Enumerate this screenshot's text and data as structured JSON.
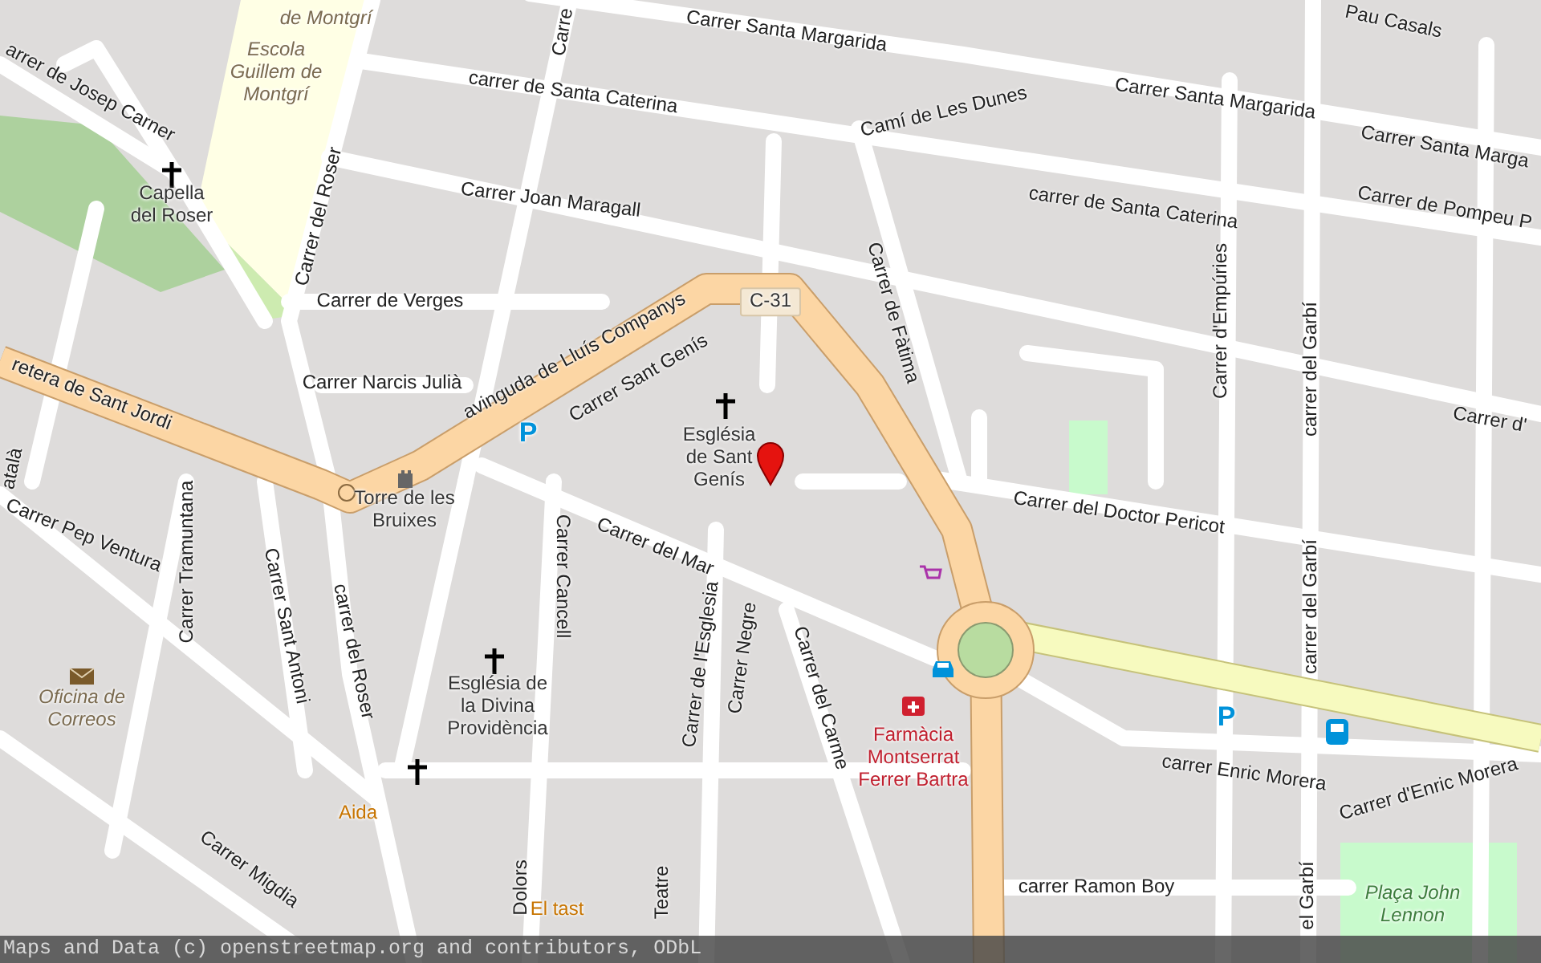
{
  "map": {
    "labels": [
      {
        "kind": "place",
        "text": "de Montgrí"
      },
      {
        "kind": "street",
        "text": "Carre"
      },
      {
        "kind": "street",
        "text": "Carrer Santa Margarida"
      },
      {
        "kind": "street",
        "text": "Pau Casals"
      },
      {
        "kind": "place",
        "text": "Escola Guillem de Montgrí"
      },
      {
        "kind": "street",
        "text": "carrer de Santa Caterina"
      },
      {
        "kind": "street",
        "text": "Camí de Les Dunes"
      },
      {
        "kind": "street",
        "text": "Carrer Santa Margarida"
      },
      {
        "kind": "street",
        "text": "Carrer Santa Marga"
      },
      {
        "kind": "street",
        "text": "arrer de Josep Carner"
      },
      {
        "kind": "street",
        "text": "carrer de Santa Caterina"
      },
      {
        "kind": "street",
        "text": "Carrer de Pompeu P"
      },
      {
        "kind": "poi",
        "text": "Capella del Roser"
      },
      {
        "kind": "street",
        "text": "Carrer del Roser"
      },
      {
        "kind": "street",
        "text": "Carrer Joan Maragall"
      },
      {
        "kind": "street",
        "text": "Carrer de Verges"
      },
      {
        "kind": "road_ref",
        "text": "C-31"
      },
      {
        "kind": "street",
        "text": "Carrer de Fàtima"
      },
      {
        "kind": "street",
        "text": "Carrer d'Empúries"
      },
      {
        "kind": "street",
        "text": "carrer del Garbí"
      },
      {
        "kind": "street",
        "text": "retera de Sant Jordi"
      },
      {
        "kind": "street",
        "text": "avinguda de Lluís Companys"
      },
      {
        "kind": "street",
        "text": "Carrer Sant Genís"
      },
      {
        "kind": "street",
        "text": "Carrer Narcis Julià"
      },
      {
        "kind": "parking",
        "text": "P"
      },
      {
        "kind": "poi",
        "text": "Església de Sant Genís"
      },
      {
        "kind": "street",
        "text": "Carrer d'"
      },
      {
        "kind": "street",
        "text": "atalà"
      },
      {
        "kind": "poi",
        "text": "Torre de les Bruixes"
      },
      {
        "kind": "street",
        "text": "Carrer del Doctor Pericot"
      },
      {
        "kind": "street",
        "text": "Carrer Pep Ventura"
      },
      {
        "kind": "street",
        "text": "Carrer Tramuntana"
      },
      {
        "kind": "street",
        "text": "Carrer Cancell"
      },
      {
        "kind": "street",
        "text": "Carrer del Mar"
      },
      {
        "kind": "street",
        "text": "Carrer Sant Antoni"
      },
      {
        "kind": "street",
        "text": "carrer del Roser"
      },
      {
        "kind": "street",
        "text": "carrer del Garbí"
      },
      {
        "kind": "street",
        "text": "Carrer de l'Esglesia"
      },
      {
        "kind": "street",
        "text": "Carrer Negre"
      },
      {
        "kind": "street",
        "text": "Carrer del Carme"
      },
      {
        "kind": "place",
        "text": "Oficina de Correos"
      },
      {
        "kind": "poi",
        "text": "Església de la Divina Providència"
      },
      {
        "kind": "parking",
        "text": "P"
      },
      {
        "kind": "health",
        "text": "Farmàcia Montserrat Ferrer Bartra"
      },
      {
        "kind": "street",
        "text": "carrer Enric Morera"
      },
      {
        "kind": "street",
        "text": "Carrer d'Enric Morera"
      },
      {
        "kind": "food",
        "text": "Aida"
      },
      {
        "kind": "street",
        "text": "Carrer Migdia"
      },
      {
        "kind": "street",
        "text": "carrer Ramon Boy"
      },
      {
        "kind": "food",
        "text": "El tast"
      },
      {
        "kind": "street",
        "text": "Dolors"
      },
      {
        "kind": "street",
        "text": "Teatre"
      },
      {
        "kind": "street",
        "text": "el Garbí"
      },
      {
        "kind": "park",
        "text": "Plaça John Lennon"
      }
    ]
  },
  "attribution": "Maps and Data (c) openstreetmap.org and contributors, ODbL"
}
